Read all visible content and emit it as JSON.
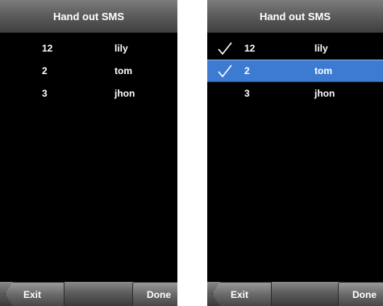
{
  "left_screen": {
    "title": "Hand out SMS",
    "rows": [
      {
        "number": "12",
        "name": "lily",
        "checked": false,
        "selected": false
      },
      {
        "number": "2",
        "name": "tom",
        "checked": false,
        "selected": false
      },
      {
        "number": "3",
        "name": "jhon",
        "checked": false,
        "selected": false
      }
    ],
    "exit_label": "Exit",
    "done_label": "Done"
  },
  "right_screen": {
    "title": "Hand out SMS",
    "rows": [
      {
        "number": "12",
        "name": "lily",
        "checked": true,
        "selected": false
      },
      {
        "number": "2",
        "name": "tom",
        "checked": true,
        "selected": true
      },
      {
        "number": "3",
        "name": "jhon",
        "checked": false,
        "selected": false
      }
    ],
    "exit_label": "Exit",
    "done_label": "Done"
  },
  "colors": {
    "selection": "#3d7bd3",
    "background": "#000000",
    "text": "#ffffff"
  },
  "icons": {
    "check": "check-icon"
  }
}
